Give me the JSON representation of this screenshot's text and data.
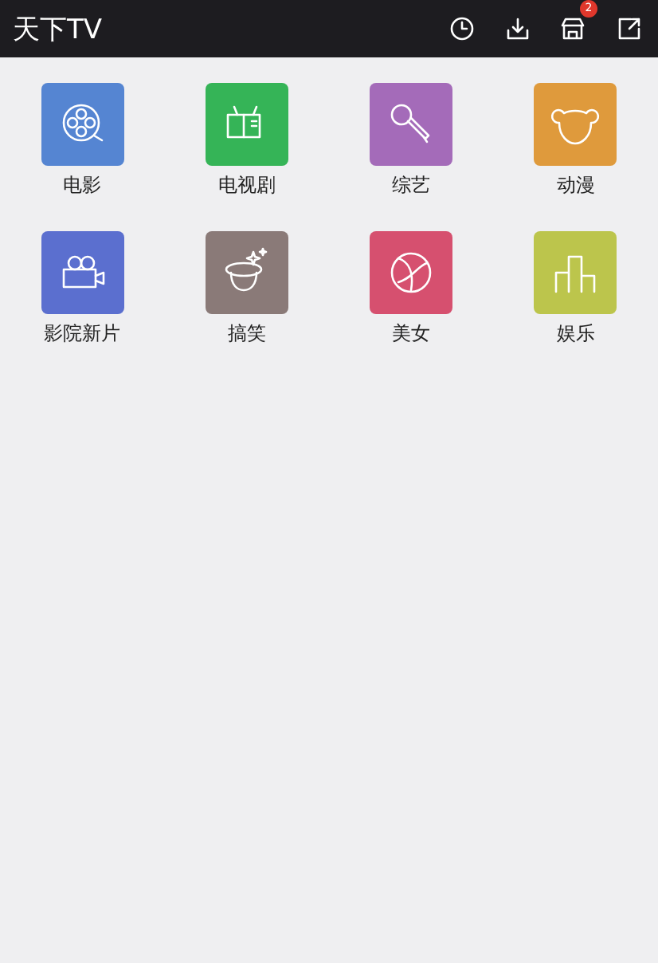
{
  "header": {
    "title": "天下TV",
    "store_badge": "2"
  },
  "categories": [
    {
      "label": "电影",
      "kind": "film",
      "color": "#5585d2"
    },
    {
      "label": "电视剧",
      "kind": "tv",
      "color": "#35b457"
    },
    {
      "label": "综艺",
      "kind": "mic",
      "color": "#a46bb9"
    },
    {
      "label": "动漫",
      "kind": "bear",
      "color": "#df9a3c"
    },
    {
      "label": "影院新片",
      "kind": "camera",
      "color": "#5b6fcf"
    },
    {
      "label": "搞笑",
      "kind": "hat",
      "color": "#8a7a78"
    },
    {
      "label": "美女",
      "kind": "ball",
      "color": "#d6506f"
    },
    {
      "label": "娱乐",
      "kind": "podium",
      "color": "#bcc54c"
    }
  ]
}
